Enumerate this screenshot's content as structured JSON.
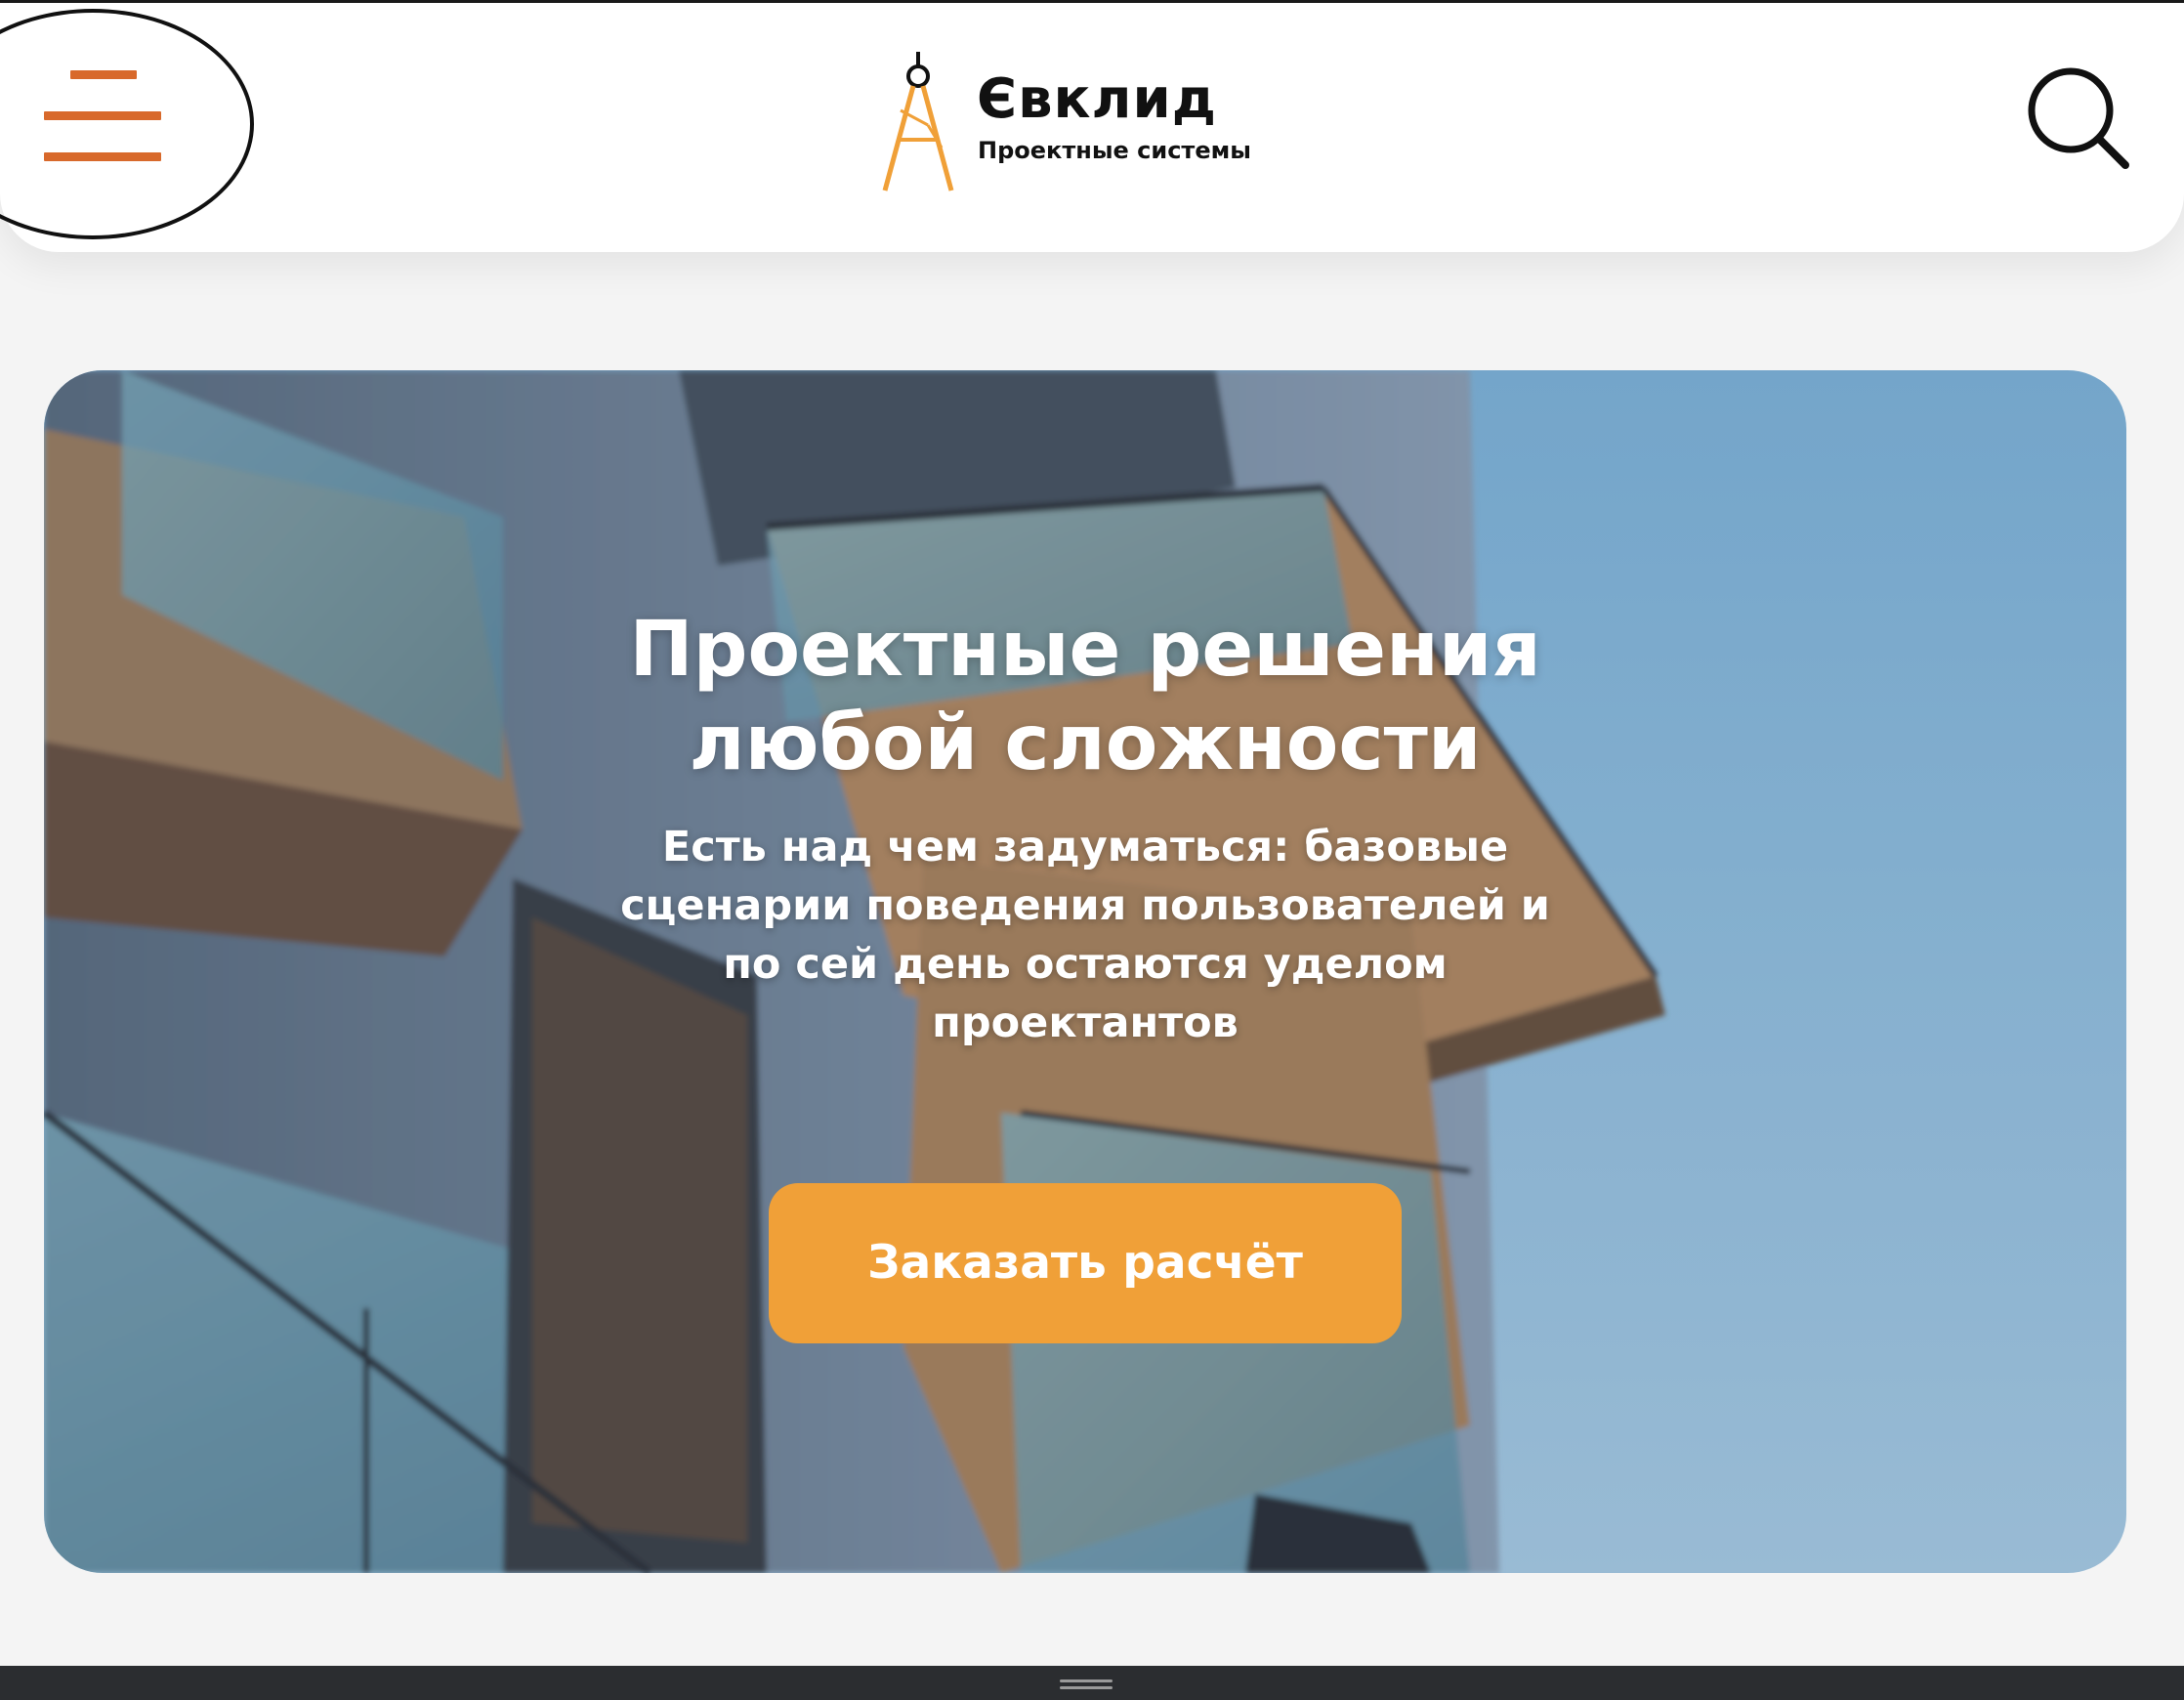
{
  "header": {
    "menu_icon": "hamburger-icon",
    "search_icon": "search-icon",
    "accent_color": "#d8692b"
  },
  "logo": {
    "name": "Євклид",
    "subtitle": "Проектные системы",
    "icon": "compass-icon",
    "icon_color": "#f0a038"
  },
  "hero": {
    "title_line1": "Проектные решения",
    "title_line2": "любой сложности",
    "subtitle": "Есть над чем задуматься: базовые сценарии поведения пользователей и по сей день остаются уделом проектантов",
    "cta_label": "Заказать расчёт",
    "cta_color": "#f0a038"
  }
}
